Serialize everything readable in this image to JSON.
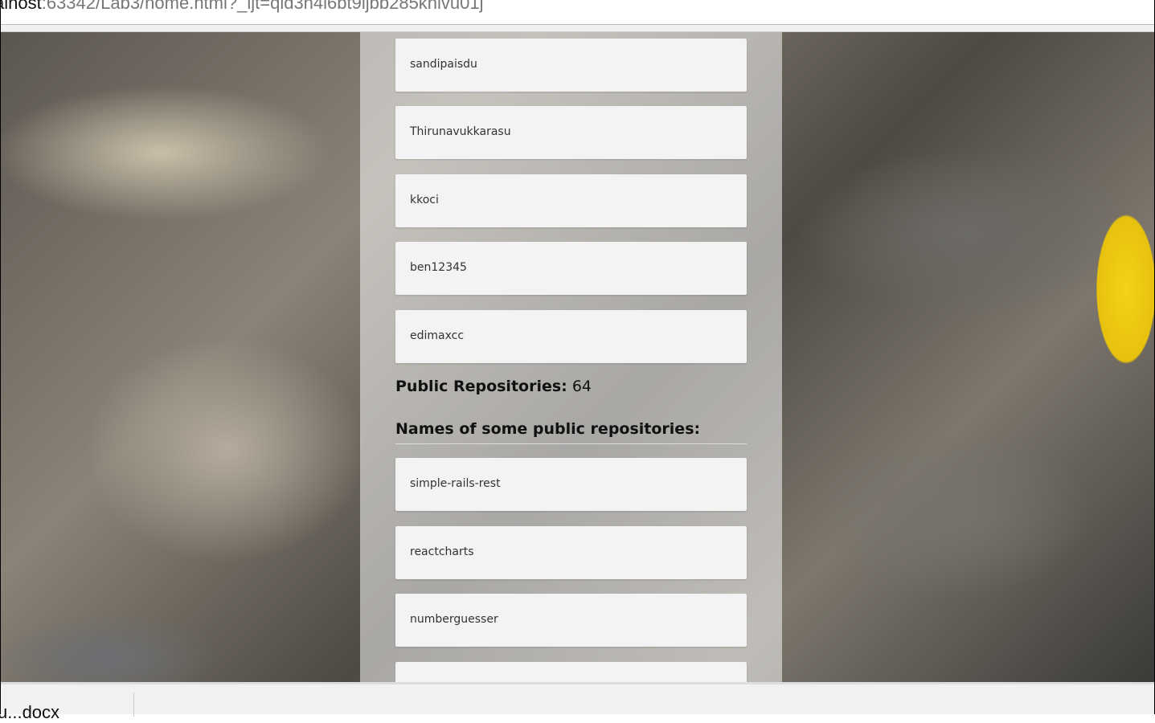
{
  "browser": {
    "url_host": "alhost",
    "url_rest": ":63342/Lab3/home.html?_ijt=qid3h4l6bt9ljbb285khlvu01j"
  },
  "followers": [
    "sandipaisdu",
    "Thirunavukkarasu",
    "kkoci",
    "ben12345",
    "edimaxcc"
  ],
  "repos_count_label": "Public Repositories:",
  "repos_count": "64",
  "repos_heading": "Names of some public repositories:",
  "repos": [
    "simple-rails-rest",
    "reactcharts",
    "numberguesser"
  ],
  "taskbar": {
    "item": "u...docx"
  }
}
